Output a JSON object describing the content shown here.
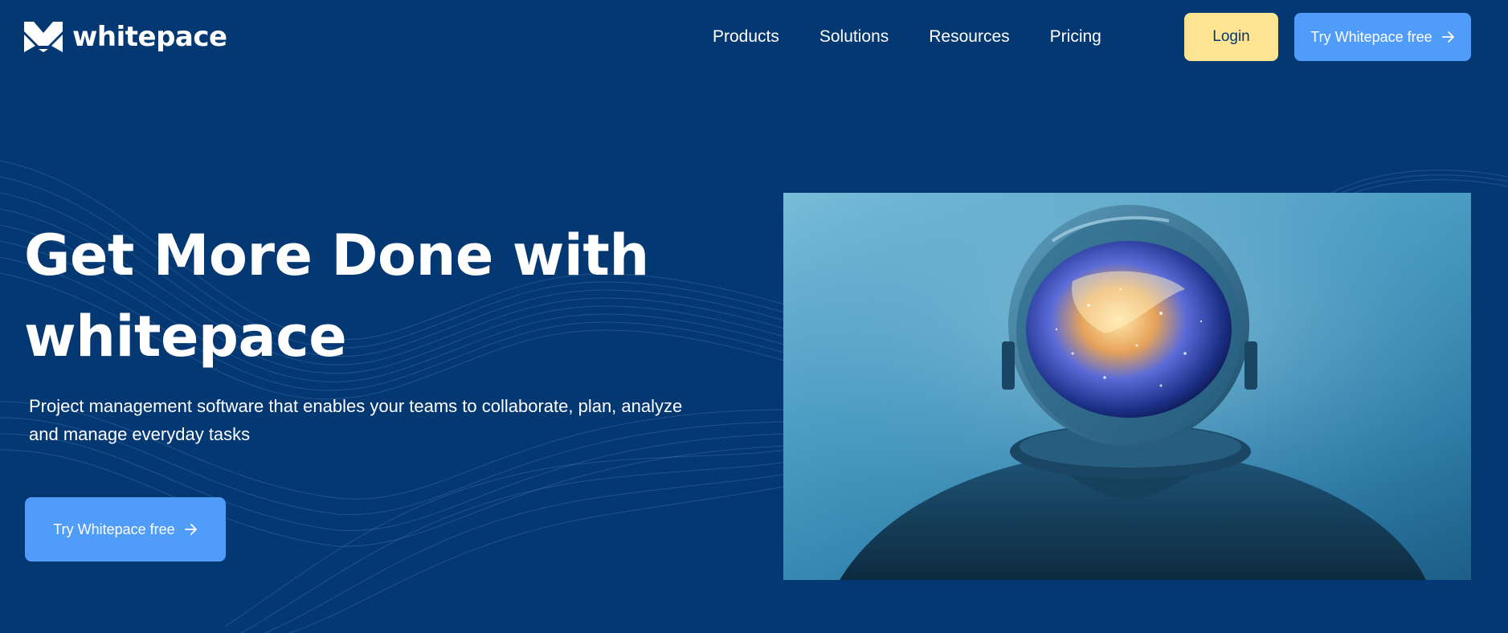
{
  "brand": {
    "name": "whitepace"
  },
  "nav": {
    "items": [
      {
        "label": "Products"
      },
      {
        "label": "Solutions"
      },
      {
        "label": "Resources"
      },
      {
        "label": "Pricing"
      }
    ]
  },
  "header": {
    "login_label": "Login",
    "try_label": "Try Whitepace free"
  },
  "hero": {
    "title_line1": "Get More Done with",
    "title_line2": "whitepace",
    "subtitle_line1": "Project management software that enables your teams to collaborate, plan, analyze",
    "subtitle_line2": "and manage everyday tasks",
    "cta_label": "Try Whitepace free"
  },
  "icons": {
    "logo": "whitepace-logo-icon",
    "arrow": "arrow-right-icon"
  },
  "colors": {
    "background": "#043873",
    "login_button": "#FFE492",
    "primary_button": "#4F9CF9",
    "text": "#FFFFFF"
  }
}
